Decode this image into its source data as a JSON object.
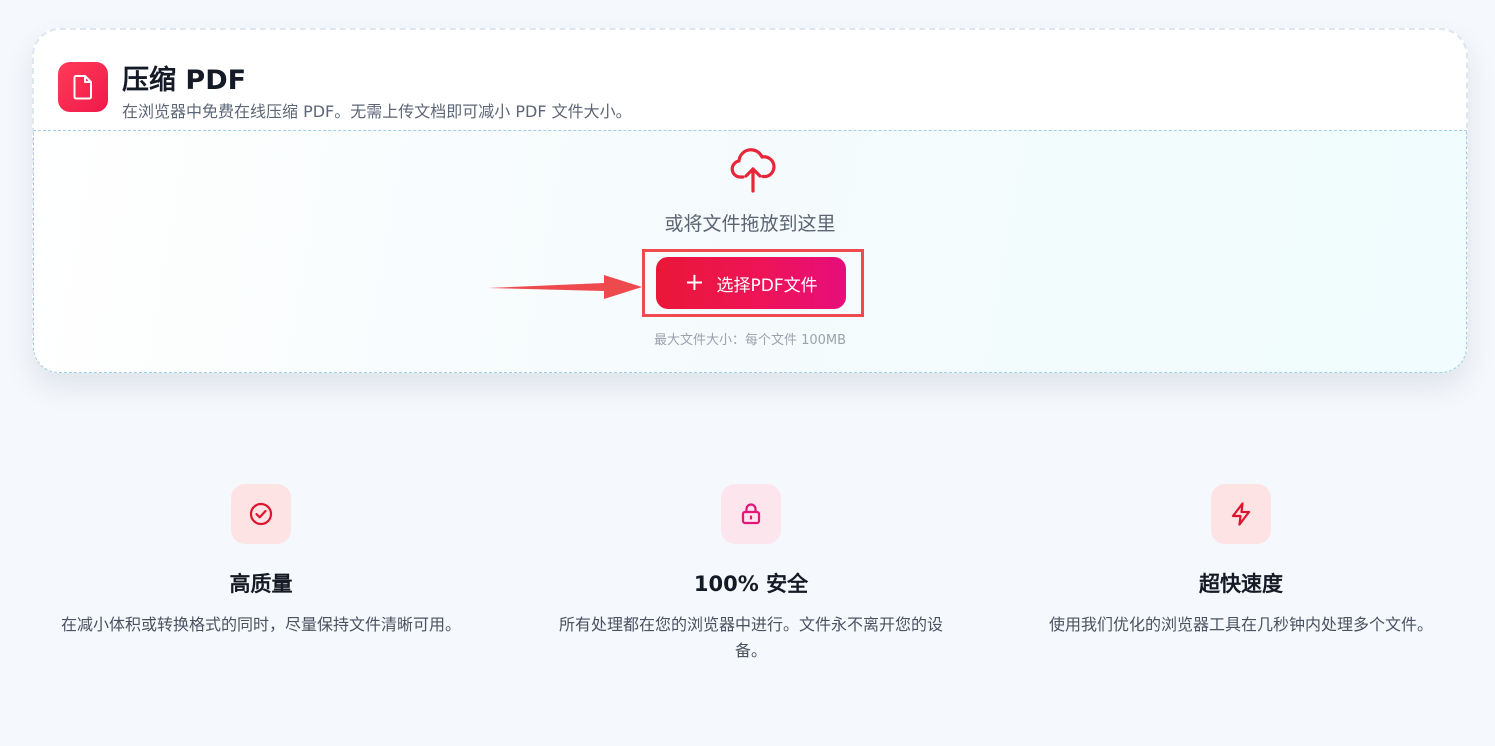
{
  "header": {
    "title": "压缩 PDF",
    "subtitle": "在浏览器中免费在线压缩 PDF。无需上传文档即可减小 PDF 文件大小。",
    "icon": "file-icon"
  },
  "dropzone": {
    "icon": "cloud-upload-icon",
    "drop_text": "或将文件拖放到这里",
    "button_label": "选择PDF文件",
    "button_icon": "plus-icon",
    "max_size_text": "最大文件大小：每个文件 100MB"
  },
  "features": [
    {
      "icon": "check-circle-icon",
      "title": "高质量",
      "description": "在减小体积或转换格式的同时，尽量保持文件清晰可用。"
    },
    {
      "icon": "lock-icon",
      "title": "100% 安全",
      "description": "所有处理都在您的浏览器中进行。文件永不离开您的设备。"
    },
    {
      "icon": "lightning-icon",
      "title": "超快速度",
      "description": "使用我们优化的浏览器工具在几秒钟内处理多个文件。"
    }
  ],
  "colors": {
    "accent": "#ee1457",
    "annotation": "#ef4a4f",
    "feature_icon_bg_red": "#fde3e3",
    "feature_icon_bg_pink": "#fde5ee"
  }
}
